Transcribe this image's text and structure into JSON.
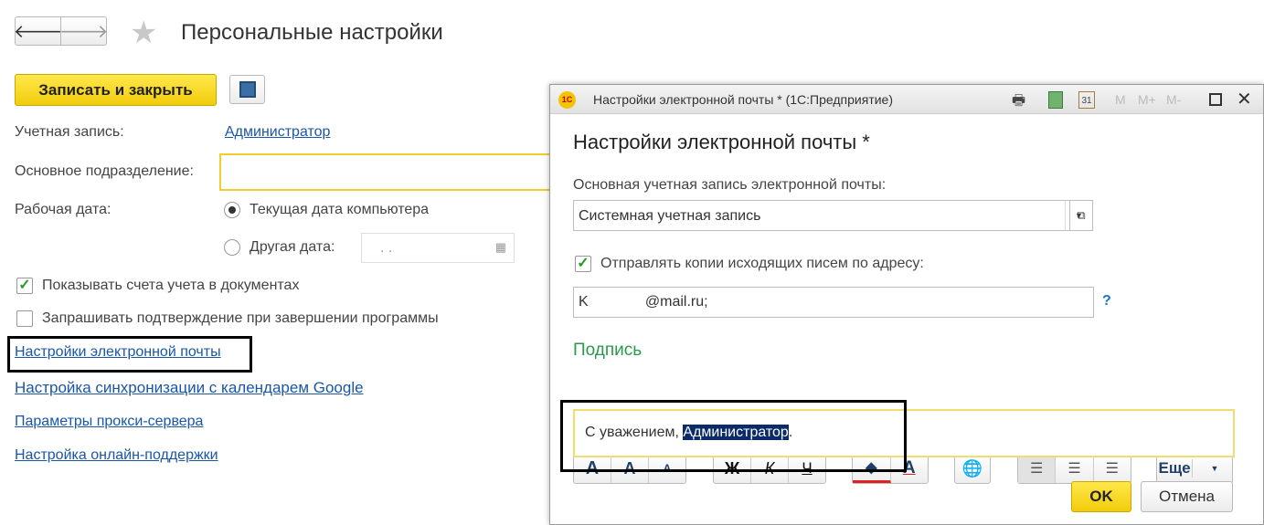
{
  "main": {
    "title": "Персональные настройки",
    "save_close": "Записать и закрыть",
    "account_label": "Учетная запись:",
    "account_value": "Администратор",
    "dept_label": "Основное подразделение:",
    "date_label": "Рабочая дата:",
    "date_opt1": "Текущая дата компьютера",
    "date_opt2": "Другая дата:",
    "date_value": " .  .",
    "chk1": "Показывать счета учета в документах",
    "chk2": "Запрашивать подтверждение при завершении программы",
    "links": [
      "Настройки электронной почты",
      "Настройка синхронизации с календарем Google",
      "Параметры прокси-сервера",
      "Настройка онлайн-поддержки"
    ]
  },
  "dialog": {
    "logo": "1С",
    "window_title": "Настройки электронной почты *  (1С:Предприятие)",
    "mem": [
      "M",
      "M+",
      "M-"
    ],
    "heading": "Настройки электронной почты *",
    "account_label": "Основная учетная запись электронной почты:",
    "account_value": "Системная учетная запись",
    "copy_label": "Отправлять копии исходящих писем по адресу:",
    "copy_value": "K              @mail.ru;",
    "help": "?",
    "signature_label": "Подпись",
    "fmt": {
      "a1": "A",
      "a2": "A",
      "a3": "A",
      "bold": "Ж",
      "italic": "К",
      "underline": "Ч",
      "color": "A",
      "more": "Еще"
    },
    "sig_prefix": "С уважением, ",
    "sig_selected": "Администратор",
    "sig_suffix": ".",
    "ok": "OK",
    "cancel": "Отмена"
  }
}
